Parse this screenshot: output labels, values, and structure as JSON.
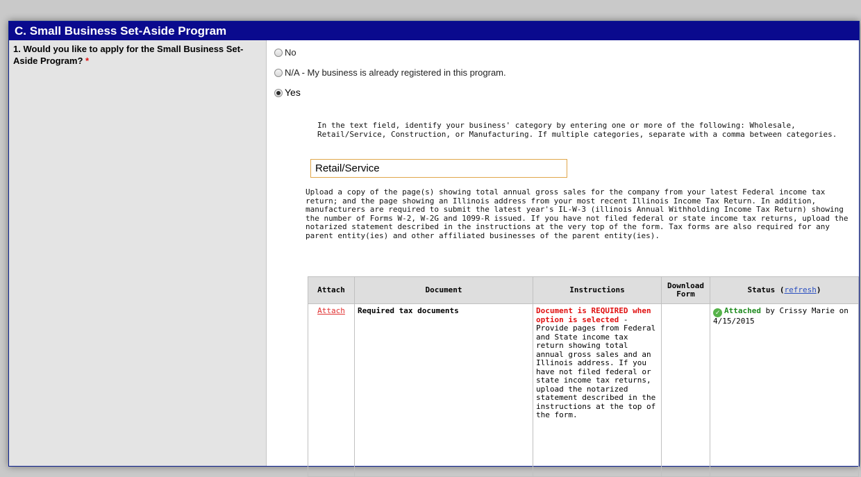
{
  "section": {
    "title": "C. Small Business Set-Aside Program"
  },
  "question": {
    "label": "1. Would you like to apply for the Small Business Set-Aside Program?",
    "required_marker": "*"
  },
  "options": [
    {
      "label": "No",
      "selected": false
    },
    {
      "label": "N/A - My business is already registered in this program.",
      "selected": false
    },
    {
      "label": "Yes",
      "selected": true
    }
  ],
  "yes_instructions": "In the text field, identify your business' category by entering one or more of the following: Wholesale, Retail/Service, Construction, or Manufacturing. If multiple categories, separate with a comma between categories.",
  "category_input": {
    "value": "Retail/Service"
  },
  "upload_instructions": "Upload a copy of the page(s) showing total annual gross sales for the company from your latest Federal income tax return; and the page showing an Illinois address from your most recent Illinois Income Tax Return. In addition, manufacturers are required to submit the latest year's IL-W-3 (illinois Annual Withholding Income Tax Return) showing the number of Forms W-2, W-2G and 1099-R issued. If you have not filed federal or state income tax returns, upload the notarized statement described in the instructions at the very top of the form. Tax forms are also required for any parent entity(ies) and other affiliated businesses of the parent entity(ies).",
  "table": {
    "headers": {
      "attach": "Attach",
      "document": "Document",
      "instructions": "Instructions",
      "download": "Download Form",
      "status": "Status",
      "refresh": "refresh"
    },
    "rows": [
      {
        "attach": "Attach",
        "document": "Required tax documents",
        "instructions_required": "Document is REQUIRED when option is selected",
        "instructions_text": "- Provide pages from Federal and State income tax return showing total annual gross sales and an Illinois address. If you have not filed federal or state income tax returns, upload the notarized statement described in the instructions at the top of the form.",
        "download": "",
        "status_icon": "check-circle-icon",
        "status_label": "Attached",
        "status_detail": "by Crissy Marie on 4/15/2015"
      }
    ]
  },
  "colors": {
    "header_bg": "#0a0a8e",
    "required": "#e01010",
    "attached": "#1e8a1e",
    "input_border": "#e0a64a"
  }
}
